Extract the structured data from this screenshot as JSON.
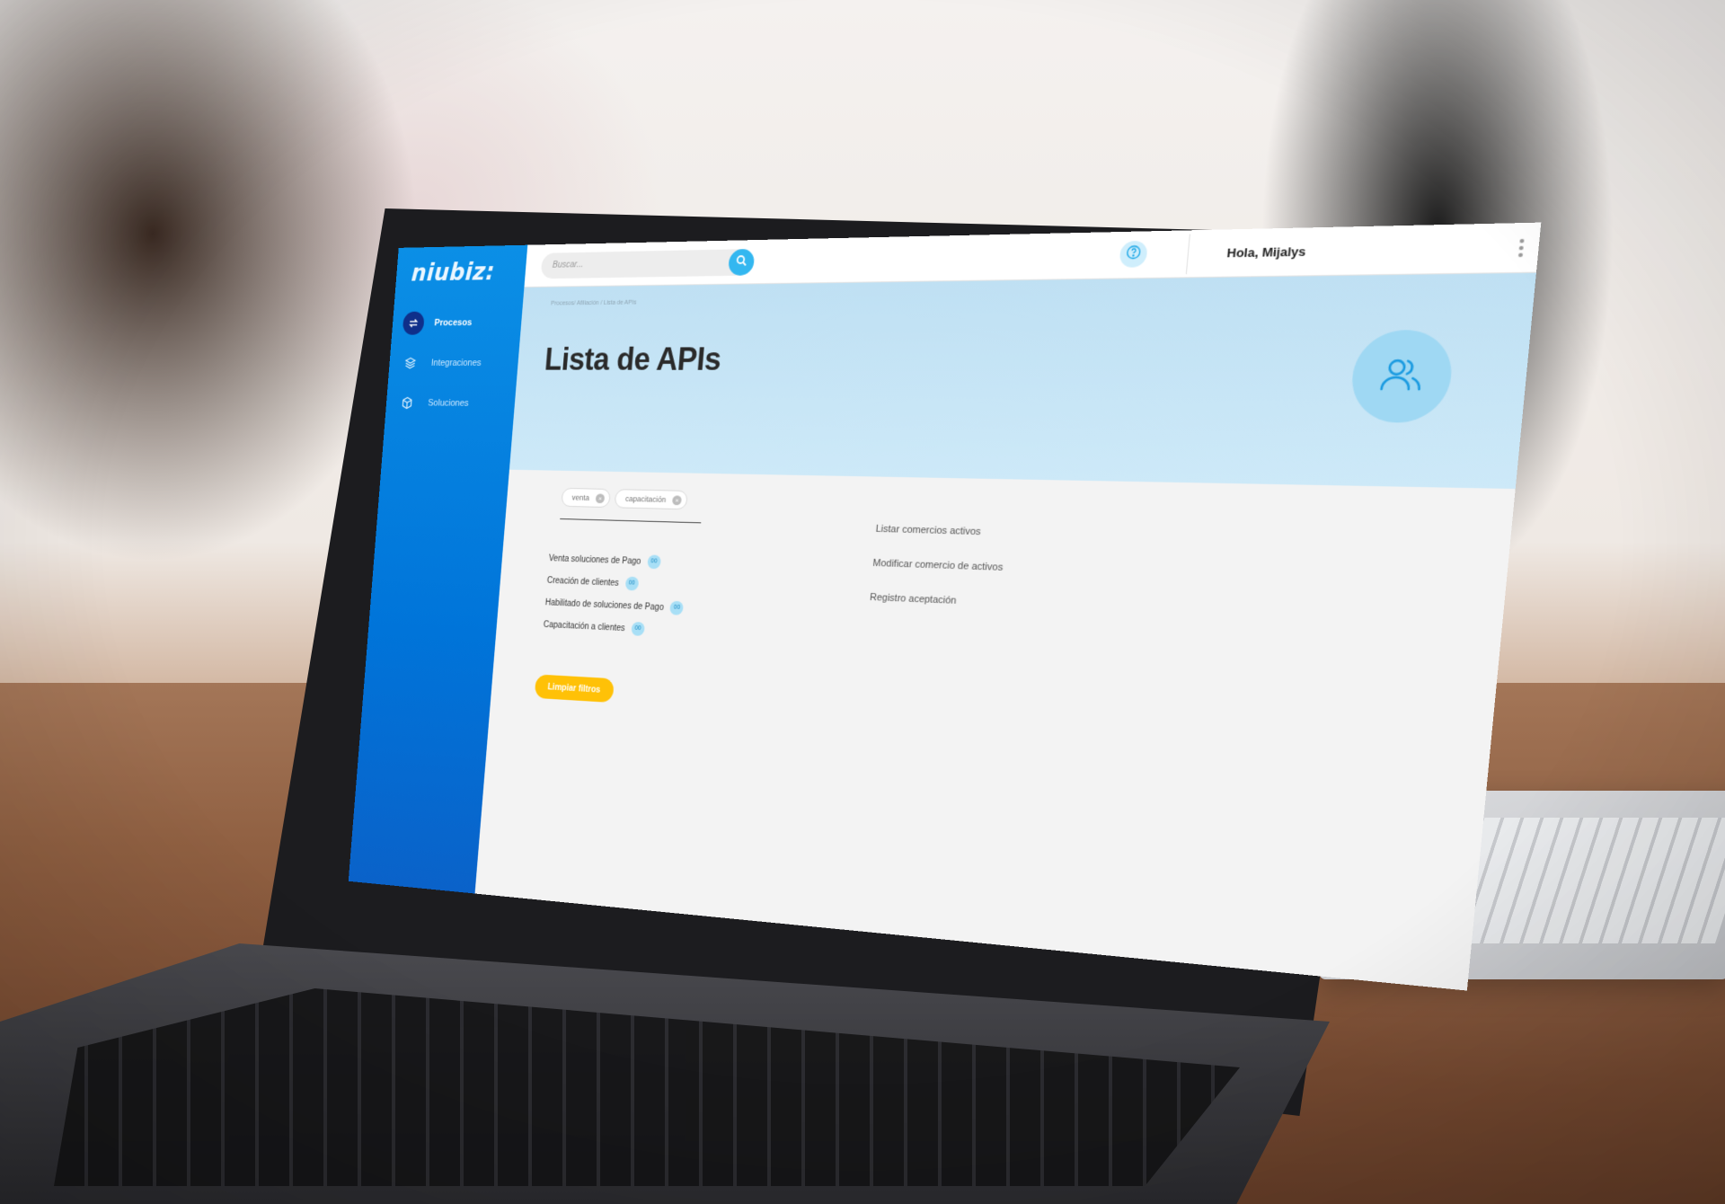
{
  "app": {
    "logo_text": "niubiz:"
  },
  "sidebar": {
    "items": [
      {
        "label": "Procesos",
        "icon": "swap-arrows-icon",
        "active": true
      },
      {
        "label": "Integraciones",
        "icon": "layers-icon",
        "active": false
      },
      {
        "label": "Soluciones",
        "icon": "cube-icon",
        "active": false
      }
    ]
  },
  "topbar": {
    "search_placeholder": "Buscar...",
    "greeting": "Hola, Mijalys"
  },
  "hero": {
    "breadcrumb": "Procesos/ Afiliación / Lista de APIs",
    "title": "Lista de APIs"
  },
  "filters": {
    "chips": [
      {
        "label": "venta"
      },
      {
        "label": "capacitación"
      }
    ],
    "items": [
      {
        "label": "Venta soluciones de Pago",
        "count": "00"
      },
      {
        "label": "Creación de clientes",
        "count": "00"
      },
      {
        "label": "Habilitado de soluciones de Pago",
        "count": "00"
      },
      {
        "label": "Capacitación a clientes",
        "count": "00"
      }
    ],
    "clear_label": "Limpiar filtros"
  },
  "apis": {
    "items": [
      "Listar comercios activos",
      "Modificar comercio de activos",
      "Registro aceptación"
    ]
  },
  "colors": {
    "sidebar": "#0074d9",
    "hero": "#c6e5f6",
    "accent": "#33b7f0",
    "button": "#ffc107"
  }
}
